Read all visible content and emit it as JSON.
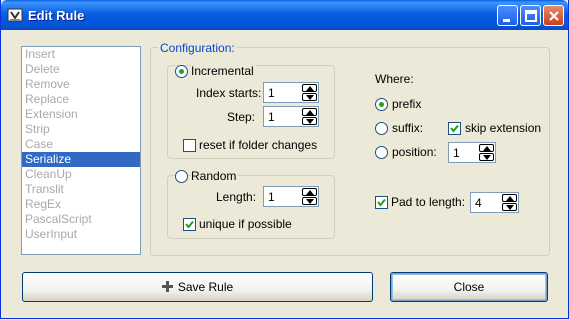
{
  "window": {
    "title": "Edit Rule"
  },
  "rules_list": {
    "items": [
      "Insert",
      "Delete",
      "Remove",
      "Replace",
      "Extension",
      "Strip",
      "Case",
      "Serialize",
      "CleanUp",
      "Translit",
      "RegEx",
      "PascalScript",
      "UserInput"
    ],
    "selected": "Serialize"
  },
  "config": {
    "label": "Configuration:",
    "incremental": {
      "label": "Incremental",
      "selected": true,
      "index_starts_label": "Index starts:",
      "index_starts_value": "1",
      "step_label": "Step:",
      "step_value": "1",
      "reset_label": "reset if folder changes",
      "reset_checked": false
    },
    "random": {
      "label": "Random",
      "selected": false,
      "length_label": "Length:",
      "length_value": "1",
      "unique_label": "unique if possible",
      "unique_checked": true
    },
    "where": {
      "label": "Where:",
      "prefix_label": "prefix",
      "prefix_selected": true,
      "suffix_label": "suffix:",
      "suffix_selected": false,
      "skip_ext_label": "skip extension",
      "skip_ext_checked": true,
      "position_label": "position:",
      "position_selected": false,
      "position_value": "1"
    },
    "pad": {
      "label": "Pad to length:",
      "checked": true,
      "value": "4"
    }
  },
  "buttons": {
    "save": "Save Rule",
    "close": "Close"
  },
  "colors": {
    "titlebar": "#0a5ee0",
    "selection": "#316ac5",
    "group_label": "#0046d5",
    "check_mark": "#21a121"
  }
}
